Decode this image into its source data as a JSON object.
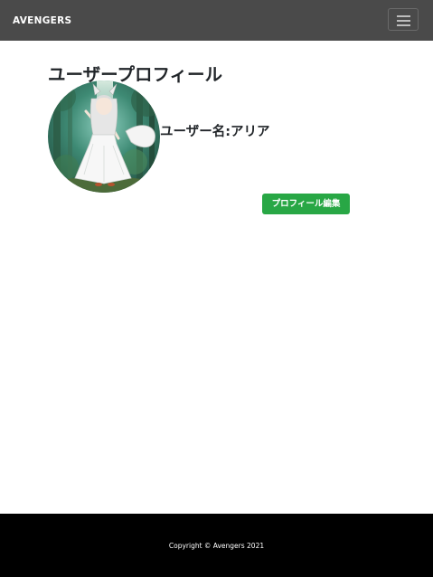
{
  "navbar": {
    "brand": "AVENGERS",
    "toggle_icon": "hamburger-menu-icon"
  },
  "main": {
    "title": "ユーザープロフィール",
    "username": "ユーザー名:アリア",
    "avatar_icon": "profile-avatar-image",
    "edit_button_label": "プロフィール編集"
  },
  "footer": {
    "copyright": "Copyright © Avengers 2021"
  },
  "colors": {
    "navbar_bg": "#4a4a4a",
    "footer_bg": "#000000",
    "button_bg": "#28a745",
    "text": "#212529"
  }
}
